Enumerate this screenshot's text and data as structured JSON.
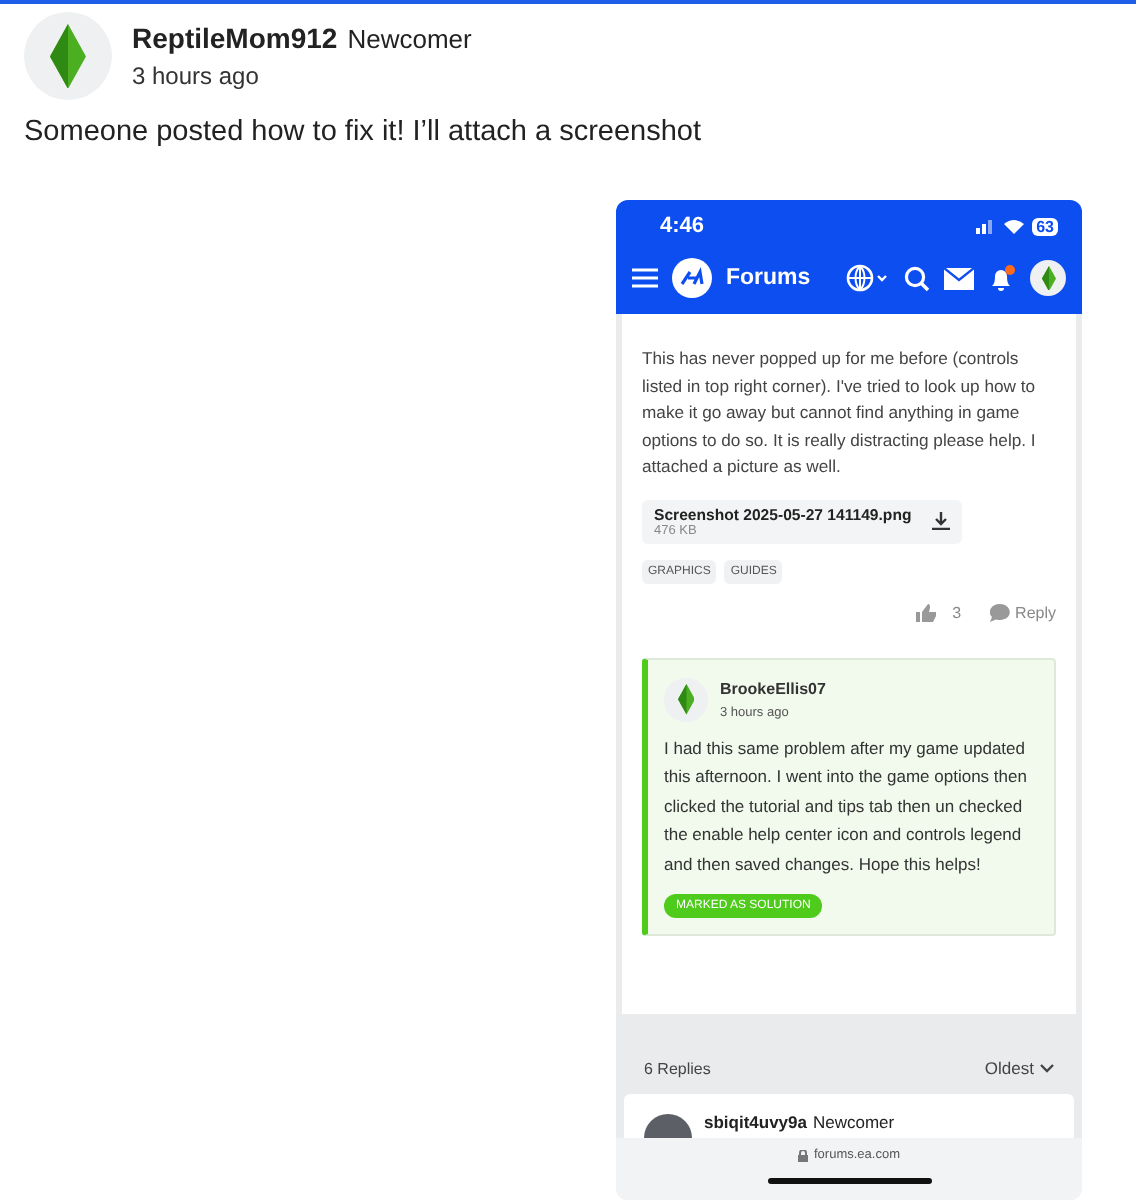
{
  "post": {
    "author": "ReptileMom912",
    "badge": "Newcomer",
    "time": "3 hours ago",
    "text": "Someone posted how to fix it! I’ll attach a screenshot"
  },
  "phone": {
    "status_bar": {
      "time": "4:46",
      "battery": "63"
    },
    "nav": {
      "brand": "Forums"
    },
    "question": {
      "text": "This has never popped up for me before (controls listed in top right corner). I've tried to look up how to make it go away but cannot find anything in game options to do so. It is really distracting please help. I attached a picture as well.",
      "attachment": {
        "name": "Screenshot 2025-05-27 141149.png",
        "size": "476 KB"
      },
      "tags": [
        "GRAPHICS",
        "GUIDES"
      ],
      "likes": "3",
      "reply": "Reply"
    },
    "solution": {
      "author": "BrookeEllis07",
      "time": "3 hours ago",
      "text": "I had this same problem after my game updated this afternoon. I went into the game options then clicked the tutorial and tips tab then un checked the enable help center icon and controls legend and then saved changes. Hope this helps!",
      "badge": "MARKED AS SOLUTION"
    },
    "replies": {
      "count": "6 Replies",
      "sort": "Oldest"
    },
    "next_reply": {
      "author": "sbiqit4uvy9a",
      "badge": "Newcomer"
    },
    "url": "forums.ea.com"
  }
}
